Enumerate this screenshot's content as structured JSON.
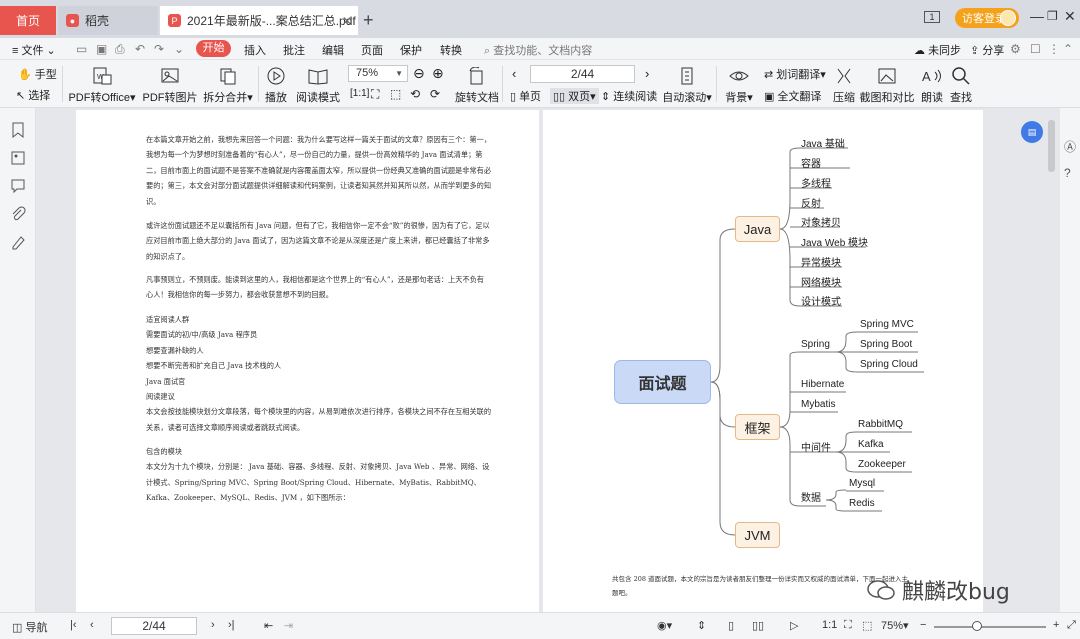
{
  "tabs": {
    "home": "首页",
    "daoke": "稻壳",
    "pdf": "2021年最新版-...案总结汇总.pdf",
    "new_tab": "+"
  },
  "header": {
    "window_number": "1",
    "visitor_login": "访客登录"
  },
  "menu": {
    "file": "文件",
    "start": "开始",
    "insert": "插入",
    "annotate": "批注",
    "edit": "编辑",
    "page": "页面",
    "protect": "保护",
    "convert": "转换",
    "search_placeholder": "查找功能、文档内容",
    "unsynced": "未同步",
    "share": "分享"
  },
  "toolbar": {
    "hand": "手型",
    "select": "选择",
    "pdf_to_office": "PDF转Office",
    "pdf_to_image": "PDF转图片",
    "split_merge": "拆分合并",
    "play": "播放",
    "read_mode": "阅读模式",
    "zoom": "75%",
    "rotate": "旋转文档",
    "page_indicator": "2/44",
    "single": "单页",
    "double": "双页",
    "continuous": "连续阅读",
    "auto_scroll": "自动滚动",
    "background": "背景",
    "translate": "划词翻译",
    "full_translate": "全文翻译",
    "compress": "压缩",
    "screenshot_compare": "截图和对比",
    "read_aloud": "朗读",
    "find": "查找"
  },
  "page1": {
    "paragraphs": [
      "在本篇文章开始之前，我想先来回答一个问题：我为什么要写这样一篇关于面试的文章？原因有三个：第一，我想为每一个为梦想时刻准备着的“有心人”，尽一份自己的力量，提供一份高效精华的 Java 面试清单；第二，目前市面上的面试题不是答案不准确就是内容覆盖面太窄，所以提供一份经典又准确的面试题是非常有必要的；第三，本文会对部分面试题提供详细解读和代码案例，让读者知其然并知其所以然，从而学到更多的知识。",
      "或许这份面试题还不足以囊括所有 Java 问题，但有了它，我相信你一定不会“败”的很惨，因为有了它，足以应对目前市面上绝大部分的 Java 面试了，因为这篇文章不论是从深度还是广度上来讲，都已经囊括了非常多的知识点了。",
      "凡事预则立，不预则废。能读到这里的人，我相信都是这个世界上的“有心人”，还是那句老话：上天不负有心人！我相信你的每一步努力，都会收获意想不到的回报。",
      "适宜阅读人群\n需要面试的初/中/高级 Java 程序员\n想要查漏补缺的人\n想要不断完善和扩充自己 Java 技术栈的人\nJava 面试官\n阅读建议\n本文会按技能模块划分文章段落，每个模块里的内容，从易到难依次进行排序，各模块之间不存在互相关联的关系，读者可选择文章顺序阅读或者跳跃式阅读。",
      "包含的模块\n本文分为十九个模块，分别是： Java 基础、容器、多线程、反射、对象拷贝、Java Web 、异常、网络、设计模式、Spring/Spring MVC、Spring Boot/Spring Cloud、Hibernate、MyBatis、RabbitMQ、Kafka、Zookeeper、MySQL、Redis、JVM ，如下图所示："
    ]
  },
  "mindmap": {
    "root": "面试题",
    "java": {
      "label": "Java",
      "items": [
        "Java 基础",
        "容器",
        "多线程",
        "反射",
        "对象拷贝",
        "Java Web 模块",
        "异常模块",
        "网络模块",
        "设计模式"
      ]
    },
    "framework": {
      "label": "框架",
      "spring": "Spring",
      "spring_items": [
        "Spring MVC",
        "Spring Boot",
        "Spring Cloud"
      ],
      "hibernate": "Hibernate",
      "mybatis": "Mybatis",
      "middleware": "中间件",
      "middleware_items": [
        "RabbitMQ",
        "Kafka",
        "Zookeeper"
      ],
      "data": "数据",
      "data_items": [
        "Mysql",
        "Redis"
      ]
    },
    "jvm": "JVM"
  },
  "page2": {
    "footer": "共包含 208 道面试题，本文的宗旨是为读者朋友们整理一份详实而又权威的面试清单，下面一起进入主题吧。",
    "watermark": "麒麟改bug"
  },
  "status": {
    "nav": "导航",
    "page": "2/44",
    "zoom": "75%"
  },
  "colors": {
    "accent_red": "#e8554e",
    "visitor_orange": "#f4a21c",
    "root_blue": "#c9d9f6",
    "branch_orange": "#fdf1e3"
  }
}
